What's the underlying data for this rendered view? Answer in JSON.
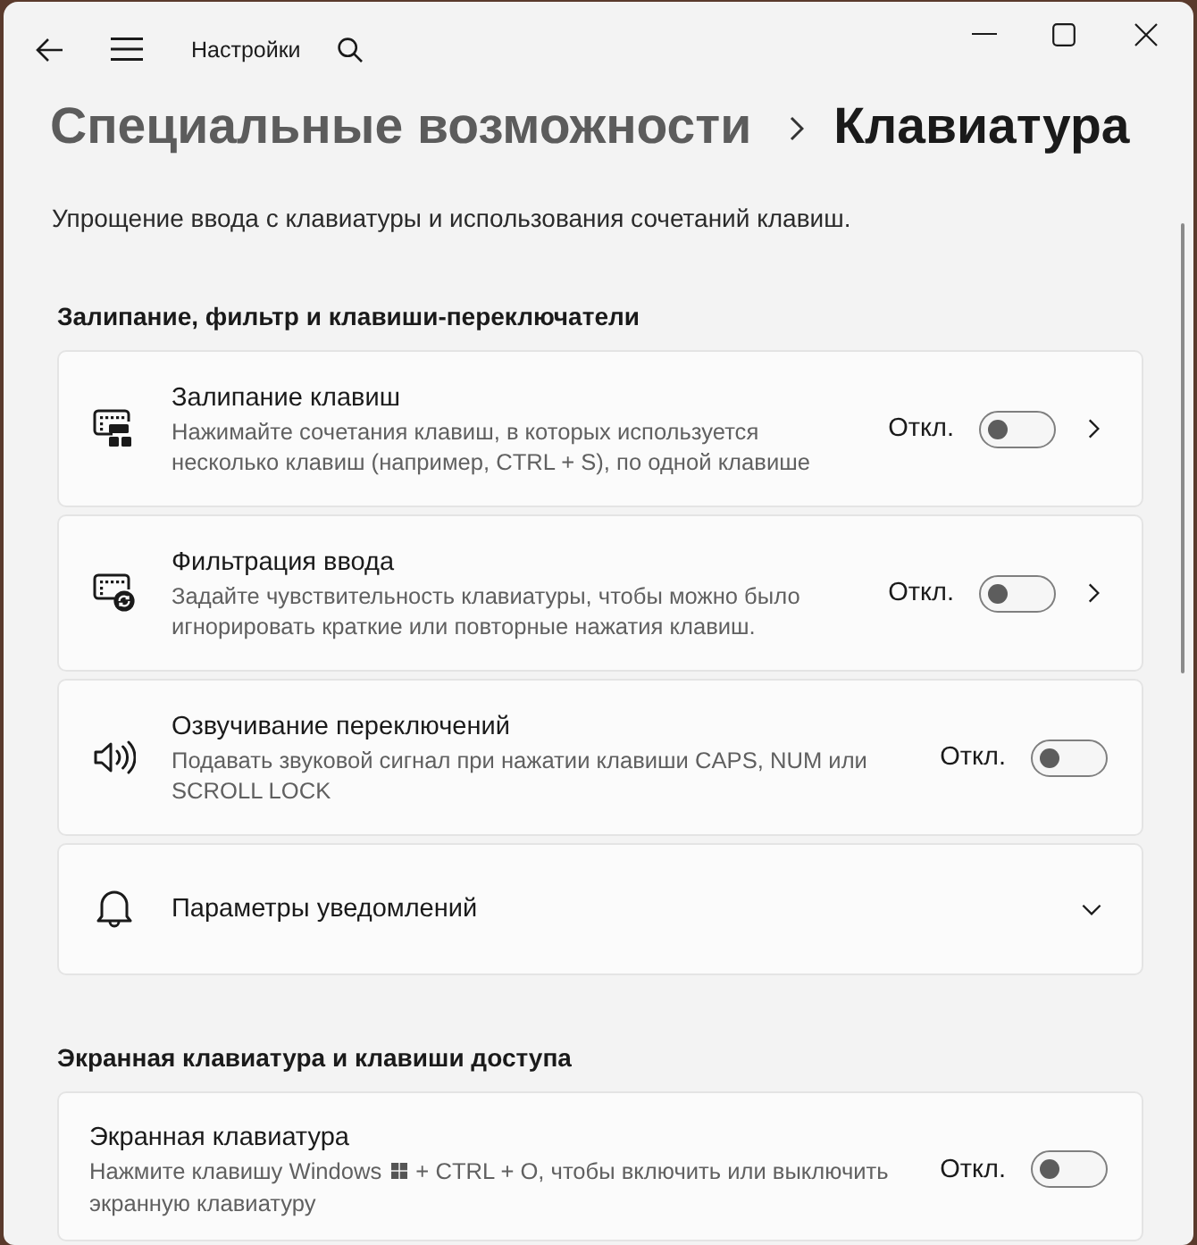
{
  "window": {
    "title": "Настройки"
  },
  "breadcrumb": [
    {
      "label": "Специальные возможности",
      "current": false
    },
    {
      "label": "Клавиатура",
      "current": true
    }
  ],
  "subtitle": "Упрощение ввода с клавиатуры и использования сочетаний клавиш.",
  "sections": [
    {
      "title": "Залипание, фильтр и клавиши-переключатели",
      "items": [
        {
          "kind": "subpage",
          "title": "Залипание клавиш",
          "description": "Нажимайте сочетания клавиш, в которых используется несколько клавиш (например, CTRL + S), по одной клавише",
          "state_label": "Откл.",
          "on": false
        },
        {
          "kind": "subpage",
          "title": "Фильтрация ввода",
          "description": "Задайте чувствительность клавиатуры, чтобы можно было игнорировать краткие или повторные нажатия клавиш.",
          "state_label": "Откл.",
          "on": false
        },
        {
          "kind": "toggle",
          "title": "Озвучивание переключений",
          "description": "Подавать звуковой сигнал при нажатии клавиши CAPS, NUM или SCROLL LOCK",
          "state_label": "Откл.",
          "on": false
        },
        {
          "kind": "expander",
          "title": "Параметры уведомлений",
          "expanded": false
        }
      ]
    },
    {
      "title": "Экранная клавиатура и клавиши доступа",
      "items": [
        {
          "kind": "toggle",
          "title": "Экранная клавиатура",
          "description_lines": [
            [
              "Нажмите клавишу Windows",
              "+ CTRL + O, чтобы включить или выключить"
            ],
            [
              "экранную клавиатуру"
            ]
          ],
          "state_label": "Откл.",
          "on": false
        }
      ]
    }
  ]
}
